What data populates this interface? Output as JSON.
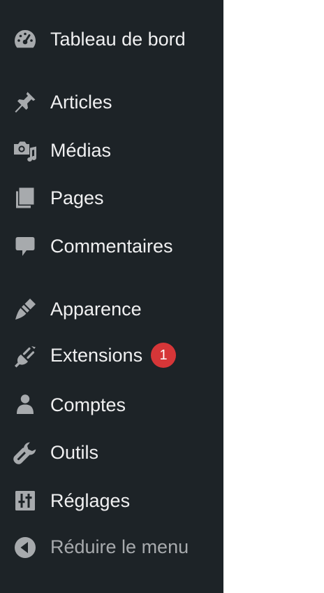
{
  "colors": {
    "sidebar_bg": "#1d2327",
    "icon": "#a7aaad",
    "label": "#f0f0f1",
    "badge_bg": "#d63638",
    "content_bg": "#ffffff"
  },
  "sidebar": {
    "items": [
      {
        "label": "Tableau de bord",
        "icon": "dashboard-icon"
      },
      {
        "label": "Articles",
        "icon": "pin-icon"
      },
      {
        "label": "Médias",
        "icon": "media-icon"
      },
      {
        "label": "Pages",
        "icon": "pages-icon"
      },
      {
        "label": "Commentaires",
        "icon": "comment-icon"
      },
      {
        "label": "Apparence",
        "icon": "paintbrush-icon"
      },
      {
        "label": "Extensions",
        "icon": "plugin-icon",
        "badge": "1"
      },
      {
        "label": "Comptes",
        "icon": "user-icon"
      },
      {
        "label": "Outils",
        "icon": "wrench-icon"
      },
      {
        "label": "Réglages",
        "icon": "settings-icon"
      }
    ],
    "collapse": {
      "label": "Réduire le menu",
      "icon": "collapse-arrow-icon"
    }
  }
}
